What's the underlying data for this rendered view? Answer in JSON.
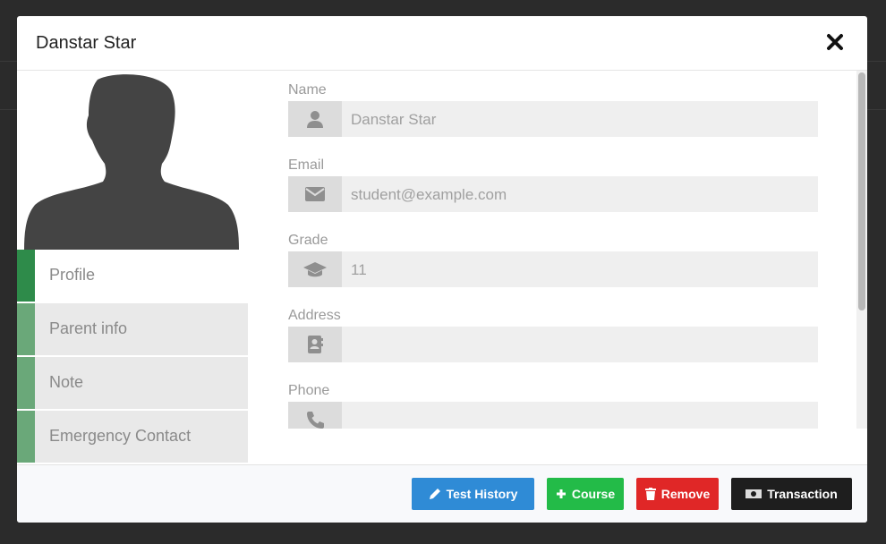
{
  "modal": {
    "title": "Danstar Star"
  },
  "tabs": [
    {
      "label": "Profile",
      "active": true
    },
    {
      "label": "Parent info",
      "active": false
    },
    {
      "label": "Note",
      "active": false
    },
    {
      "label": "Emergency Contact",
      "active": false
    }
  ],
  "form": {
    "name": {
      "label": "Name",
      "value": "Danstar Star",
      "icon": "user-icon"
    },
    "email": {
      "label": "Email",
      "value": "student@example.com",
      "icon": "envelope-icon"
    },
    "grade": {
      "label": "Grade",
      "value": "11",
      "icon": "graduation-cap-icon"
    },
    "address": {
      "label": "Address",
      "value": "",
      "icon": "address-book-icon"
    },
    "phone": {
      "label": "Phone",
      "value": "",
      "icon": "phone-icon"
    }
  },
  "footer": {
    "test_history": "Test History",
    "course": "Course",
    "remove": "Remove",
    "transaction": "Transaction"
  },
  "colors": {
    "active_tab_accent": "#2e8b4a",
    "tab_accent": "#6aa879",
    "blue": "#2f8bd6",
    "green": "#23bb48",
    "red": "#e02727",
    "black": "#1e1e1e"
  }
}
